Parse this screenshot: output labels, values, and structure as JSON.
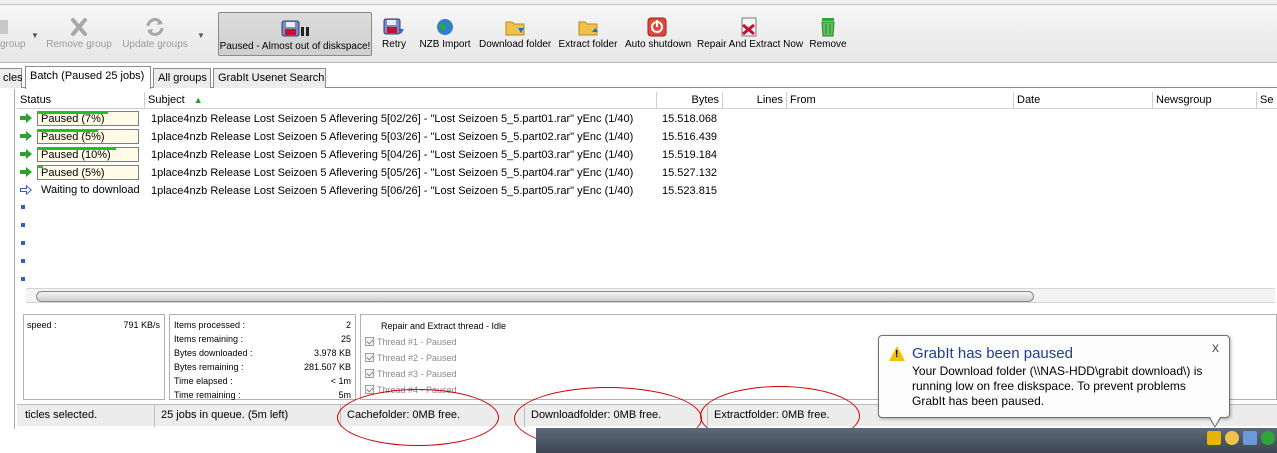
{
  "toolbar": {
    "items": [
      {
        "label": "group",
        "icon": "add-group-icon",
        "state": "disabled"
      },
      {
        "label": "Remove group",
        "icon": "remove-group-icon",
        "state": "disabled"
      },
      {
        "label": "Update groups",
        "icon": "update-groups-icon",
        "state": "disabled"
      },
      {
        "label": "Paused - Almost out of diskspace!",
        "icon": "paused-disk-icon",
        "state": "pressed"
      },
      {
        "label": "Retry",
        "icon": "retry-icon",
        "state": "normal"
      },
      {
        "label": "NZB Import",
        "icon": "nzb-import-icon",
        "state": "normal"
      },
      {
        "label": "Download folder",
        "icon": "download-folder-icon",
        "state": "normal"
      },
      {
        "label": "Extract folder",
        "icon": "extract-folder-icon",
        "state": "normal"
      },
      {
        "label": "Auto shutdown",
        "icon": "auto-shutdown-icon",
        "state": "normal"
      },
      {
        "label": "Repair And Extract Now",
        "icon": "repair-extract-icon",
        "state": "normal"
      },
      {
        "label": "Remove",
        "icon": "trash-icon",
        "state": "normal"
      }
    ]
  },
  "tabs": [
    {
      "label": "cles"
    },
    {
      "label": "Batch (Paused 25 jobs)",
      "active": true
    },
    {
      "label": "All groups"
    },
    {
      "label": "GrabIt Usenet Search"
    }
  ],
  "grid": {
    "columns": [
      "Status",
      "Subject",
      "Bytes",
      "Lines",
      "From",
      "Date",
      "Newsgroup",
      "Se"
    ],
    "rows": [
      {
        "status": "Paused (7%)",
        "progress": 0.7,
        "subject": "1place4nzb Release Lost Seizoen 5 Aflevering 5[02/26] - \"Lost Seizoen 5_5.part01.rar\" yEnc (1/40)",
        "bytes": "15.518.068"
      },
      {
        "status": "Paused (5%)",
        "progress": 0.6,
        "subject": "1place4nzb Release Lost Seizoen 5 Aflevering 5[03/26] - \"Lost Seizoen 5_5.part02.rar\" yEnc (1/40)",
        "bytes": "15.516.439"
      },
      {
        "status": "Paused (10%)",
        "progress": 0.78,
        "subject": "1place4nzb Release Lost Seizoen 5 Aflevering 5[04/26] - \"Lost Seizoen 5_5.part03.rar\" yEnc (1/40)",
        "bytes": "15.519.184"
      },
      {
        "status": "Paused (5%)",
        "progress": 0.05,
        "subject": "1place4nzb Release Lost Seizoen 5 Aflevering 5[05/26] - \"Lost Seizoen 5_5.part04.rar\" yEnc (1/40)",
        "bytes": "15.527.132"
      },
      {
        "status": "Waiting to download",
        "progress": null,
        "subject": "1place4nzb Release Lost Seizoen 5 Aflevering 5[06/26] - \"Lost Seizoen 5_5.part05.rar\" yEnc (1/40)",
        "bytes": "15.523.815"
      }
    ]
  },
  "speed": {
    "label": "speed :",
    "value": "791 KB/s"
  },
  "stats": [
    {
      "label": "Items processed :",
      "value": "2"
    },
    {
      "label": "Items remaining :",
      "value": "25"
    },
    {
      "label": "Bytes downloaded :",
      "value": "3.978 KB"
    },
    {
      "label": "Bytes remaining :",
      "value": "281.507 KB"
    },
    {
      "label": "Time elapsed :",
      "value": "< 1m"
    },
    {
      "label": "Time remaining :",
      "value": "5m"
    }
  ],
  "threads": {
    "title": "Repair and Extract thread - Idle",
    "items": [
      "Thread #1 - Paused",
      "Thread #2 - Paused",
      "Thread #3 - Paused",
      "Thread #4 - Paused"
    ]
  },
  "statusbar": {
    "selected": "ticles selected.",
    "queue": "25 jobs in queue. (5m left)",
    "cache": "Cachefolder: 0MB free.",
    "download": "Downloadfolder: 0MB free.",
    "extract": "Extractfolder: 0MB free."
  },
  "balloon": {
    "title": "GrabIt has been paused",
    "body": "Your Download folder (\\\\NAS-HDD\\grabit download\\) is running low on free diskspace. To prevent problems GrabIt has been paused.",
    "close": "x"
  },
  "colors": {
    "highlight": "#d00000",
    "progress": "#1ec21e",
    "title": "#1d3d93"
  }
}
